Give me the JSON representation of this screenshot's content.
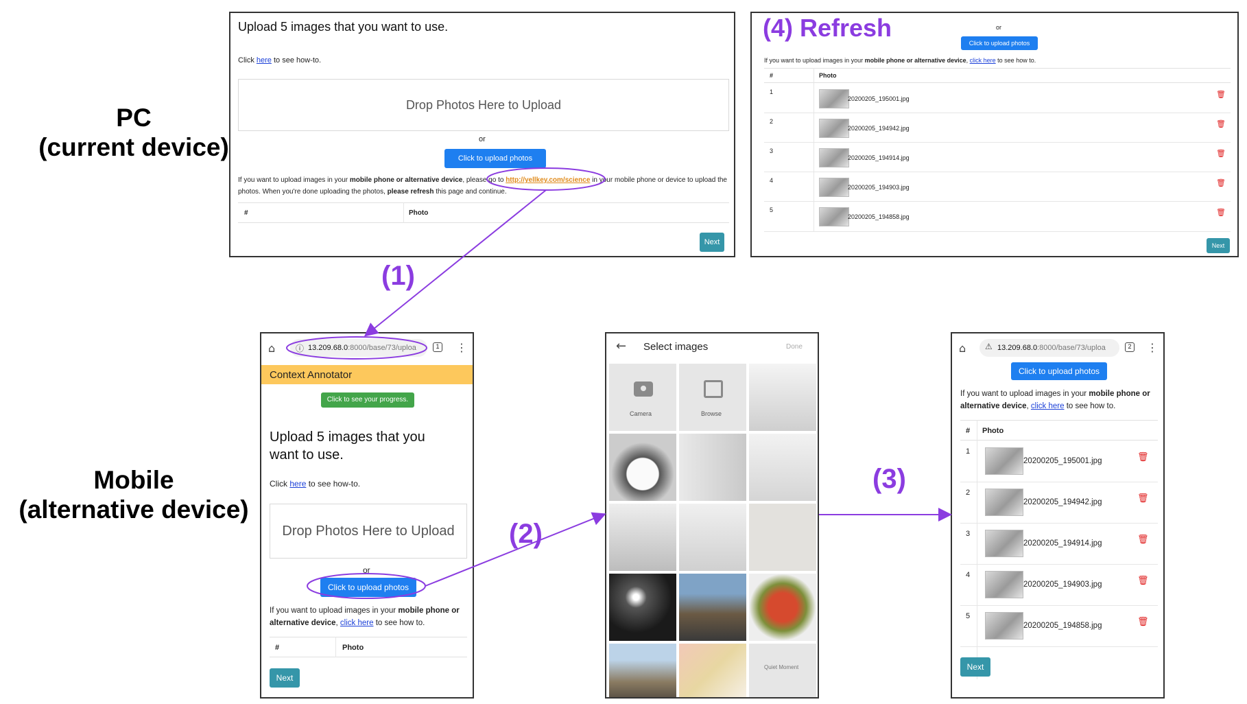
{
  "labels": {
    "pc": [
      "PC",
      "(current device)"
    ],
    "mobile": [
      "Mobile",
      "(alternative device)"
    ],
    "step1": "(1)",
    "step2": "(2)",
    "step3": "(3)",
    "step4": "(4) Refresh"
  },
  "pc_upload": {
    "title": "Upload 5 images that you want to use.",
    "howto_pre": "Click ",
    "howto_link": "here",
    "howto_post": " to see how-to.",
    "dropzone": "Drop Photos Here to Upload",
    "or": "or",
    "upload_button": "Click to upload photos",
    "instr_1": "If you want to upload images in your ",
    "instr_bold": "mobile phone or alternative device",
    "instr_2": ", please go to ",
    "instr_link": "http://yellkey.com/science",
    "instr_3": " in your mobile phone or device to upload the",
    "instr_4": "photos. When you're done uploading the photos, ",
    "instr_bold2": "please refresh",
    "instr_5": " this page and continue.",
    "col_num": "#",
    "col_photo": "Photo",
    "next": "Next"
  },
  "pc_refreshed": {
    "or": "or",
    "upload_button": "Click to upload photos",
    "instr_1": "If you want to upload images in your ",
    "instr_bold": "mobile phone or alternative device",
    "instr_2": ", ",
    "instr_link": "click here",
    "instr_3": " to see how to.",
    "col_num": "#",
    "col_photo": "Photo",
    "rows": [
      {
        "num": "1",
        "file": "20200205_195001.jpg"
      },
      {
        "num": "2",
        "file": "20200205_194942.jpg"
      },
      {
        "num": "3",
        "file": "20200205_194914.jpg"
      },
      {
        "num": "4",
        "file": "20200205_194903.jpg"
      },
      {
        "num": "5",
        "file": "20200205_194858.jpg"
      }
    ],
    "next": "Next"
  },
  "mobile_upload": {
    "url_host": "13.209.68.0",
    "url_path": ":8000/base/73/uploa",
    "tab_count": "1",
    "app_title": "Context Annotator",
    "progress_button": "Click to see your progress.",
    "title": "Upload 5 images that you want to use.",
    "howto_pre": "Click ",
    "howto_link": "here",
    "howto_post": " to see how-to.",
    "dropzone": "Drop Photos Here to Upload",
    "or": "or",
    "upload_button": "Click to upload photos",
    "instr_1": "If you want to upload images in your ",
    "instr_bold": "mobile phone or",
    "instr_bold_b": "alternative device",
    "instr_2": ", ",
    "instr_link": "click here",
    "instr_3": " to see how to.",
    "col_num": "#",
    "col_photo": "Photo",
    "next": "Next"
  },
  "gallery": {
    "title": "Select images",
    "done": "Done",
    "camera": "Camera",
    "browse": "Browse",
    "last_tile_text": "Quiet Moment"
  },
  "mobile_refreshed": {
    "url_host": "13.209.68.0",
    "url_path": ":8000/base/73/uploa",
    "tab_count": "2",
    "upload_button": "Click to upload photos",
    "instr_1": "If you want to upload images in your ",
    "instr_bold": "mobile phone or",
    "instr_bold_b": "alternative device",
    "instr_2": ", ",
    "instr_link": "click here",
    "instr_3": " to see how to.",
    "col_num": "#",
    "col_photo": "Photo",
    "rows": [
      {
        "num": "1",
        "file": "20200205_195001.jpg"
      },
      {
        "num": "2",
        "file": "20200205_194942.jpg"
      },
      {
        "num": "3",
        "file": "20200205_194914.jpg"
      },
      {
        "num": "4",
        "file": "20200205_194903.jpg"
      },
      {
        "num": "5",
        "file": "20200205_194858.jpg"
      }
    ],
    "next": "Next"
  },
  "colors": {
    "annotation_purple": "#8b3ce0",
    "button_blue": "#1e7ff0",
    "button_teal": "#3596a9",
    "button_green": "#43a54a",
    "header_yellow": "#fdc85c",
    "trash_red": "#e02020"
  },
  "icons": [
    "home-icon",
    "info-icon",
    "warning-icon",
    "more-vert-icon",
    "back-arrow-icon",
    "camera-icon",
    "image-icon",
    "trash-icon"
  ]
}
